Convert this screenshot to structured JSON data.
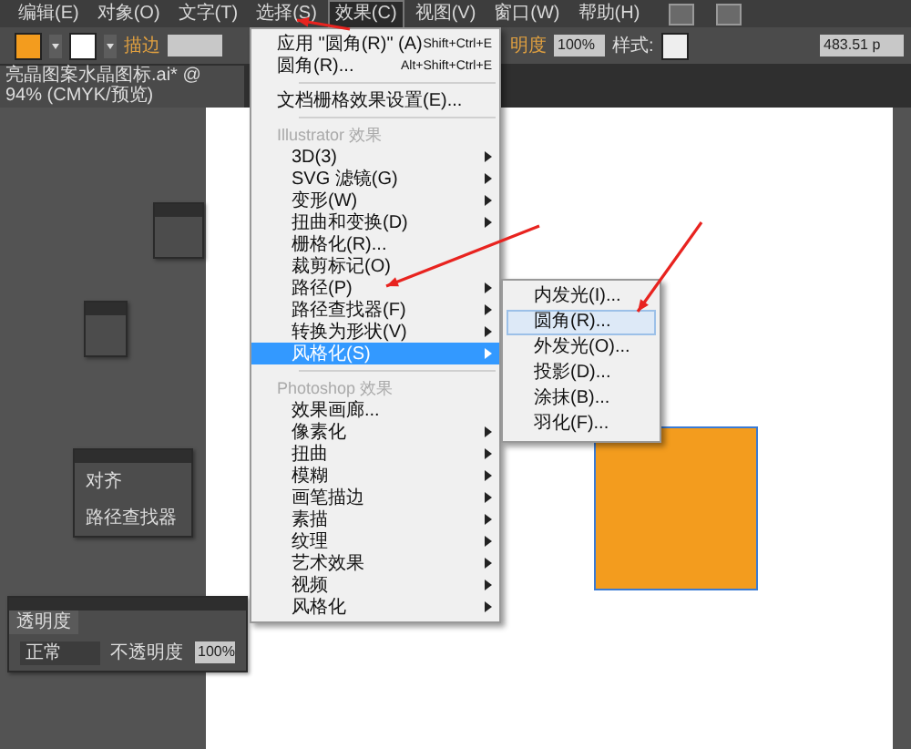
{
  "menu_bar": [
    {
      "label": "编辑(E)",
      "selected": false
    },
    {
      "label": "对象(O)",
      "selected": false
    },
    {
      "label": "文字(T)",
      "selected": false
    },
    {
      "label": "选择(S)",
      "selected": false
    },
    {
      "label": "效果(C)",
      "selected": true
    },
    {
      "label": "视图(V)",
      "selected": false
    },
    {
      "label": "窗口(W)",
      "selected": false
    },
    {
      "label": "帮助(H)",
      "selected": false
    }
  ],
  "options_bar": {
    "stroke_label": "描边",
    "opacity_label": "明度",
    "opacity": "100%",
    "style_label": "样式:",
    "coordinate": "483.51 p"
  },
  "document_tab": {
    "title": "亮晶图案水晶图标.ai* @ 94% (CMYK/预览)"
  },
  "effect_menu": {
    "sections": [
      {
        "items": [
          {
            "label": "应用 \"圆角(R)\" (A)",
            "shortcut": "Shift+Ctrl+E",
            "submenu": false,
            "selected": false
          },
          {
            "label": "圆角(R)...",
            "shortcut": "Alt+Shift+Ctrl+E",
            "submenu": false,
            "selected": false
          }
        ]
      },
      {
        "items": [
          {
            "label": "文档栅格效果设置(E)...",
            "submenu": false,
            "selected": false
          }
        ]
      },
      {
        "title": "Illustrator 效果",
        "items": [
          {
            "label": "3D(3)",
            "submenu": true,
            "selected": false
          },
          {
            "label": "SVG 滤镜(G)",
            "submenu": true,
            "selected": false
          },
          {
            "label": "变形(W)",
            "submenu": true,
            "selected": false
          },
          {
            "label": "扭曲和变换(D)",
            "submenu": true,
            "selected": false
          },
          {
            "label": "栅格化(R)...",
            "submenu": false,
            "selected": false
          },
          {
            "label": "裁剪标记(O)",
            "submenu": false,
            "selected": false
          },
          {
            "label": "路径(P)",
            "submenu": true,
            "selected": false
          },
          {
            "label": "路径查找器(F)",
            "submenu": true,
            "selected": false
          },
          {
            "label": "转换为形状(V)",
            "submenu": true,
            "selected": false
          },
          {
            "label": "风格化(S)",
            "submenu": true,
            "selected": true
          }
        ]
      },
      {
        "title": "Photoshop 效果",
        "items": [
          {
            "label": "效果画廊...",
            "submenu": false,
            "selected": false
          },
          {
            "label": "像素化",
            "submenu": true,
            "selected": false
          },
          {
            "label": "扭曲",
            "submenu": true,
            "selected": false
          },
          {
            "label": "模糊",
            "submenu": true,
            "selected": false
          },
          {
            "label": "画笔描边",
            "submenu": true,
            "selected": false
          },
          {
            "label": "素描",
            "submenu": true,
            "selected": false
          },
          {
            "label": "纹理",
            "submenu": true,
            "selected": false
          },
          {
            "label": "艺术效果",
            "submenu": true,
            "selected": false
          },
          {
            "label": "视频",
            "submenu": true,
            "selected": false
          },
          {
            "label": "风格化",
            "submenu": true,
            "selected": false
          }
        ]
      }
    ]
  },
  "stylize_submenu": [
    {
      "label": "内发光(I)...",
      "selected": false
    },
    {
      "label": "圆角(R)...",
      "selected": true
    },
    {
      "label": "外发光(O)...",
      "selected": false
    },
    {
      "label": "投影(D)...",
      "selected": false
    },
    {
      "label": "涂抹(B)...",
      "selected": false
    },
    {
      "label": "羽化(F)...",
      "selected": false
    }
  ],
  "align_panel": {
    "items": [
      "对齐",
      "路径查找器"
    ]
  },
  "transparency_panel": {
    "tab": "透明度",
    "blend_mode": "正常",
    "opacity_label": "不透明度",
    "opacity": "100%"
  }
}
